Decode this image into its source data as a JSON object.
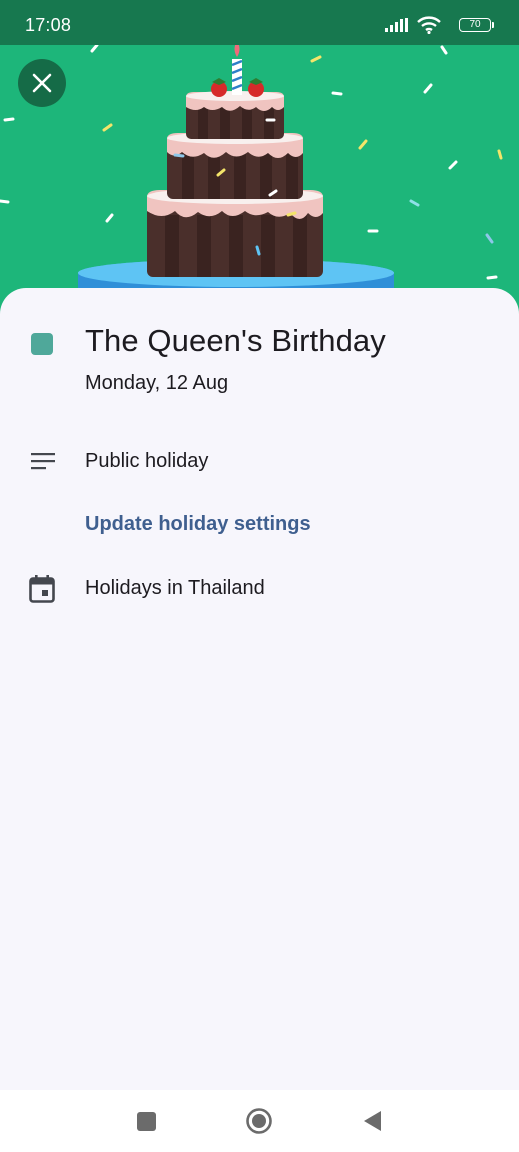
{
  "status_bar": {
    "time": "17:08",
    "battery": "70",
    "icons": [
      "signal-icon",
      "wifi-icon",
      "battery-icon"
    ]
  },
  "header": {
    "illustration": "birthday-cake",
    "close_icon": "close-icon",
    "background_color": "#1db67a"
  },
  "event": {
    "title": "The Queen's Birthday",
    "date": "Monday, 12 Aug",
    "calendar_color": "#4fa89a",
    "type_icon": "description-icon",
    "type": "Public holiday",
    "settings_link": "Update holiday settings",
    "calendar_icon": "calendar-icon",
    "calendar_name": "Holidays in Thailand"
  },
  "nav_bar": {
    "icons": [
      "recents-icon",
      "home-icon",
      "back-icon"
    ]
  }
}
